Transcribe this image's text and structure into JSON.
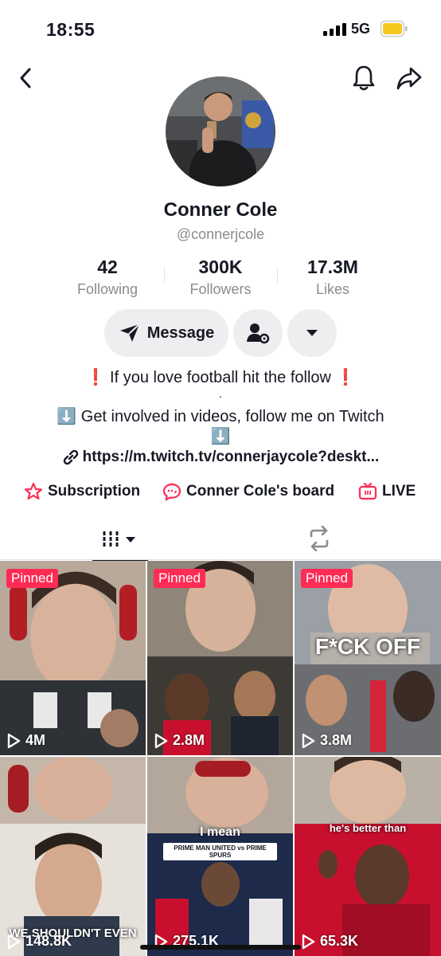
{
  "status_bar": {
    "time": "18:55",
    "network": "5G"
  },
  "profile": {
    "name": "Conner Cole",
    "handle": "@connerjcole",
    "stats": [
      {
        "value": "42",
        "label": "Following"
      },
      {
        "value": "300K",
        "label": "Followers"
      },
      {
        "value": "17.3M",
        "label": "Likes"
      }
    ],
    "message_label": "Message",
    "bio_lines": [
      "❗ If you love football hit the follow ❗",
      ".",
      "⬇️ Get involved in videos, follow me on Twitch",
      "⬇️"
    ],
    "link": "https://m.twitch.tv/connerjaycole?deskt...",
    "quick_links": [
      {
        "label": "Subscription",
        "icon": "subscription-star-icon"
      },
      {
        "label": "Conner Cole's board",
        "icon": "board-chat-icon"
      },
      {
        "label": "LIVE",
        "icon": "live-tv-icon"
      }
    ]
  },
  "tabs": [
    {
      "name": "videos-grid-icon",
      "active": true
    },
    {
      "name": "reposts-icon",
      "active": false
    }
  ],
  "colors": {
    "accent": "#fe2c55",
    "text": "#161823",
    "muted": "#8a8b91"
  },
  "videos": [
    {
      "pinned_label": "Pinned",
      "views": "4M",
      "caption": ""
    },
    {
      "pinned_label": "Pinned",
      "views": "2.8M",
      "caption": ""
    },
    {
      "pinned_label": "Pinned",
      "views": "3.8M",
      "caption": "F*CK OFF"
    },
    {
      "pinned_label": "",
      "views": "148.8K",
      "caption": "WE SHOULDN'T EVEN"
    },
    {
      "pinned_label": "",
      "views": "275.1K",
      "caption": "I mean",
      "sub_caption": "PRIME MAN UNITED vs PRIME SPURS"
    },
    {
      "pinned_label": "",
      "views": "65.3K",
      "caption": "he's better than"
    }
  ]
}
